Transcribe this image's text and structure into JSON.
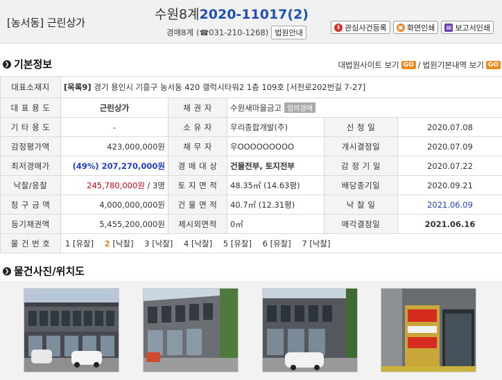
{
  "header": {
    "category": "[농서동] 근린상가",
    "court": "수원8계",
    "case_no": "2020-11017(2)",
    "dept": "경매8계",
    "phone": "031-210-1268",
    "court_info_btn": "법원안내",
    "buttons": {
      "watch": "관심사건등록",
      "print_screen": "화면인쇄",
      "print_report": "보고서인쇄"
    }
  },
  "basic": {
    "title": "기본정보",
    "link_supreme": "대법원사이트 보기",
    "link_court": "법원기본내역 보기",
    "go": "GO",
    "sep": "/"
  },
  "rows": {
    "addr_label": "대표소재지",
    "addr_tag": "[목록9]",
    "addr_value": " 경기 용인시 기흥구 농서동 420 갤럭시타워2 1층 109호 [서천로202번길 7-27]",
    "use_label": "대 표 용 도",
    "use_value": "근린상가",
    "creditor_label": "채 권 자",
    "creditor_value": "수원새마을금고",
    "creditor_badge": "임의경매",
    "other_use_label": "기 타 용 도",
    "other_use_value": "-",
    "owner_label": "소 유 자",
    "owner_value": "우리종합개발(주)",
    "apply_label": "신 청 일",
    "apply_value": "2020.07.08",
    "appraisal_label": "감정평가액",
    "appraisal_value": "423,000,000원",
    "debtor_label": "채 무 자",
    "debtor_value": "우OOOOOOOOO",
    "start_label": "개시결정일",
    "start_value": "2020.07.09",
    "min_label": "최저경매가",
    "min_value": "(49%) 207,270,000원",
    "target_label": "경 매 대 상",
    "target_value": "건물전부, 토지전부",
    "appr_date_label": "감 정 기 일",
    "appr_date_value": "2020.07.22",
    "bid_label": "낙찰/응찰",
    "bid_value": "245,780,000원",
    "bid_count": " / 3명",
    "land_label": "토 지 면 적",
    "land_value": "48.35㎡ (14.63평)",
    "div_label": "배당종기일",
    "div_value": "2020.09.21",
    "claim_label": "청 구 금 액",
    "claim_value": "4,000,000,000원",
    "bldg_label": "건 물 면 적",
    "bldg_value": "40.7㎡ (12.31평)",
    "win_label": "낙 찰 일",
    "win_value": "2021.06.09",
    "reg_label": "등기채권액",
    "reg_value": "5,455,200,000원",
    "excl_label": "제시외면적",
    "excl_value": "0㎡",
    "sale_label": "매각결정일",
    "sale_value": "2021.06.16",
    "history_label": "물 건 번 호",
    "history": [
      {
        "num": "1",
        "status": "[유찰]"
      },
      {
        "num": "2",
        "status": "[낙찰]"
      },
      {
        "num": "3",
        "status": "[낙찰]"
      },
      {
        "num": "4",
        "status": "[낙찰]"
      },
      {
        "num": "5",
        "status": "[유찰]"
      },
      {
        "num": "6",
        "status": "[유찰]"
      },
      {
        "num": "7",
        "status": "[낙찰]"
      }
    ]
  },
  "photos_section": {
    "title": "물건사진/위치도"
  },
  "colors": {
    "case_blue": "#1f4fb8",
    "go_orange": "#f08a1c",
    "highlight_orange": "#e7862a",
    "bid_red": "#d0021b",
    "min_blue": "#1f3fc0"
  }
}
